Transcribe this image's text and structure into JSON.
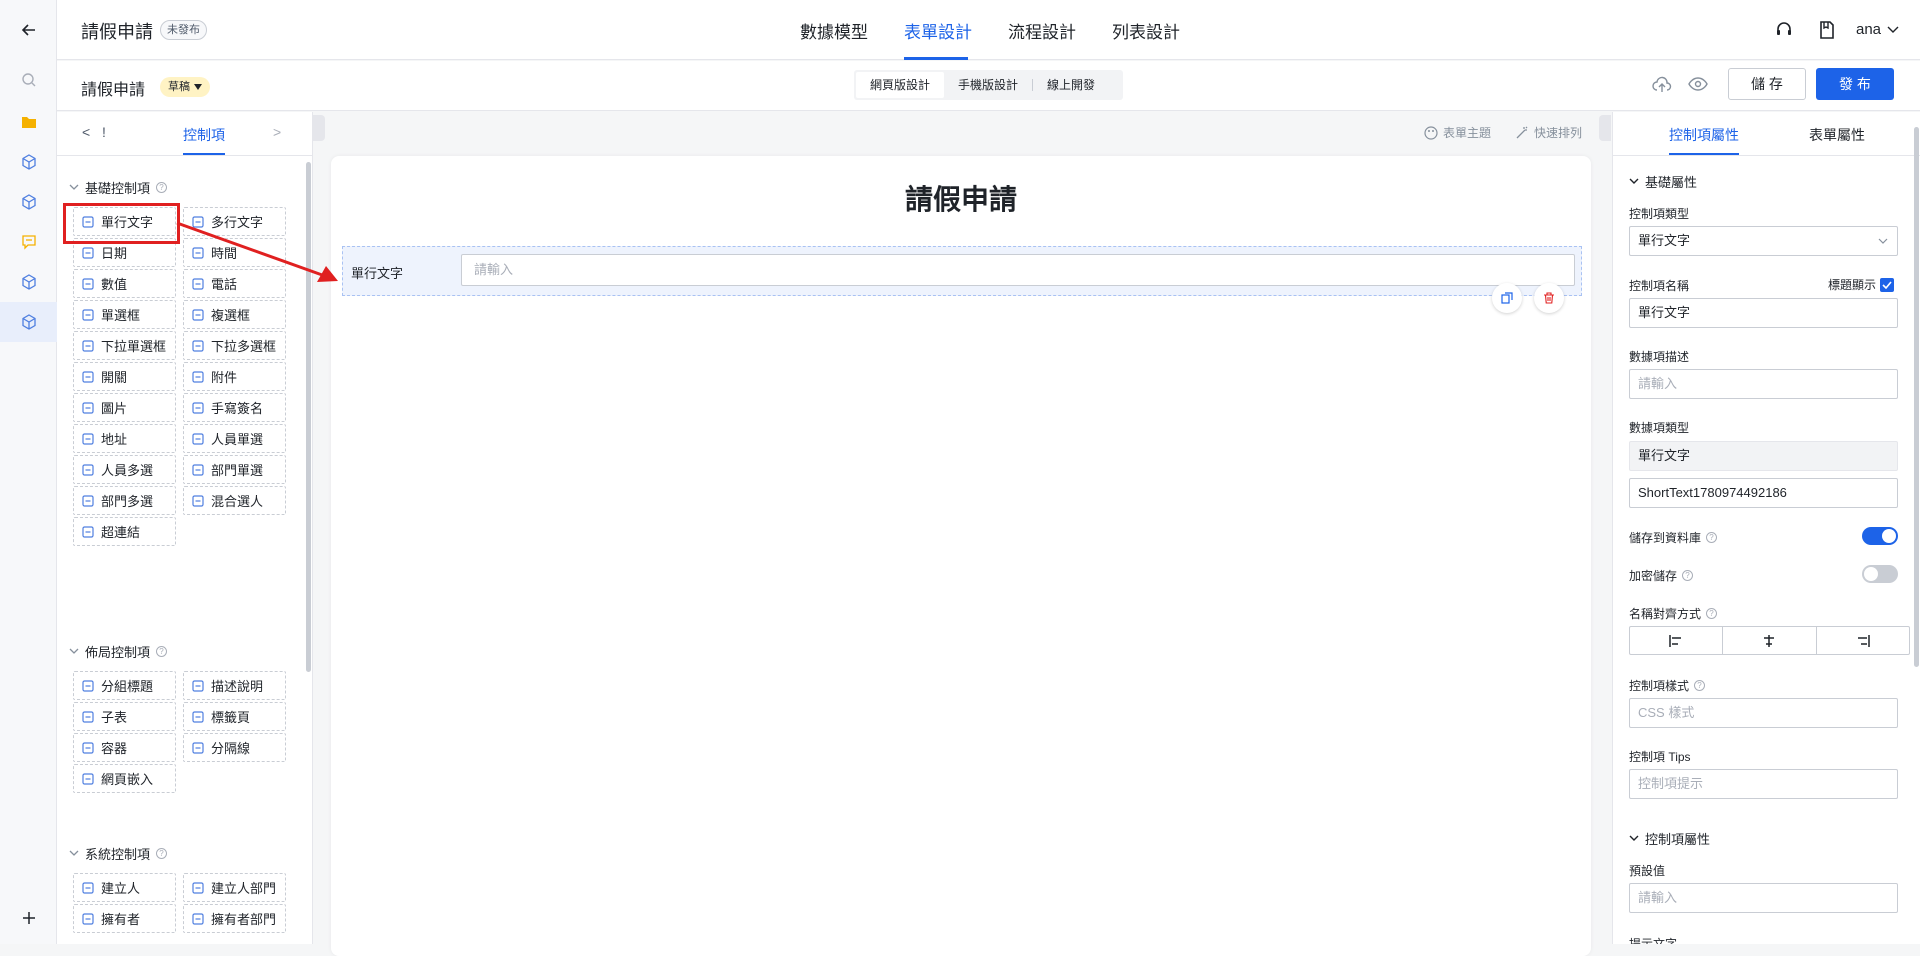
{
  "header": {
    "app_title": "請假申請",
    "status_badge": "未發布",
    "tabs": [
      "數據模型",
      "表單設計",
      "流程設計",
      "列表設計"
    ],
    "active_tab": "表單設計",
    "user": "ana"
  },
  "subheader": {
    "form_name": "請假申請",
    "draft_badge": "草稿",
    "modes": [
      "網頁版設計",
      "手機版設計",
      "線上開發"
    ],
    "save_label": "儲 存",
    "publish_label": "發 布"
  },
  "left_panel": {
    "nav_back": "<",
    "nav_mark": "!",
    "tab_label": "控制項",
    "nav_next": ">",
    "sections": [
      {
        "title": "基礎控制項",
        "items": [
          {
            "label": "單行文字",
            "icon": "single-line-text-icon"
          },
          {
            "label": "多行文字",
            "icon": "multi-line-text-icon"
          },
          {
            "label": "日期",
            "icon": "date-icon"
          },
          {
            "label": "時間",
            "icon": "time-icon"
          },
          {
            "label": "數值",
            "icon": "number-icon"
          },
          {
            "label": "電話",
            "icon": "phone-icon"
          },
          {
            "label": "單選框",
            "icon": "radio-icon"
          },
          {
            "label": "複選框",
            "icon": "checkbox-icon"
          },
          {
            "label": "下拉單選框",
            "icon": "dropdown-single-icon"
          },
          {
            "label": "下拉多選框",
            "icon": "dropdown-multi-icon"
          },
          {
            "label": "開關",
            "icon": "switch-icon"
          },
          {
            "label": "附件",
            "icon": "attachment-icon"
          },
          {
            "label": "圖片",
            "icon": "image-icon"
          },
          {
            "label": "手寫簽名",
            "icon": "signature-icon"
          },
          {
            "label": "地址",
            "icon": "address-icon"
          },
          {
            "label": "人員單選",
            "icon": "person-single-icon"
          },
          {
            "label": "人員多選",
            "icon": "person-multi-icon"
          },
          {
            "label": "部門單選",
            "icon": "dept-single-icon"
          },
          {
            "label": "部門多選",
            "icon": "dept-multi-icon"
          },
          {
            "label": "混合選人",
            "icon": "mixed-select-icon"
          },
          {
            "label": "超連結",
            "icon": "link-icon"
          }
        ]
      },
      {
        "title": "佈局控制項",
        "items": [
          {
            "label": "分組標題",
            "icon": "group-title-icon"
          },
          {
            "label": "描述說明",
            "icon": "description-icon"
          },
          {
            "label": "子表",
            "icon": "subtable-icon"
          },
          {
            "label": "標籤頁",
            "icon": "tabs-icon"
          },
          {
            "label": "容器",
            "icon": "container-icon"
          },
          {
            "label": "分隔線",
            "icon": "divider-icon"
          },
          {
            "label": "網頁嵌入",
            "icon": "webpage-embed-icon"
          }
        ]
      },
      {
        "title": "系統控制項",
        "items": [
          {
            "label": "建立人",
            "icon": "creator-icon"
          },
          {
            "label": "建立人部門",
            "icon": "creator-dept-icon"
          },
          {
            "label": "擁有者",
            "icon": "owner-icon"
          },
          {
            "label": "擁有者部門",
            "icon": "owner-dept-icon"
          }
        ]
      }
    ]
  },
  "canvas": {
    "tool_theme": "表單主題",
    "tool_arrange": "快速排列",
    "form_title": "請假申請",
    "field_label": "單行文字",
    "field_placeholder": "請輸入"
  },
  "right_panel": {
    "tabs": [
      "控制項屬性",
      "表單屬性"
    ],
    "basic_section": "基礎屬性",
    "control_type_label": "控制項類型",
    "control_type_value": "單行文字",
    "control_name_label": "控制項名稱",
    "title_display_label": "標題顯示",
    "control_name_value": "單行文字",
    "data_desc_label": "數據項描述",
    "data_desc_placeholder": "請輸入",
    "data_type_label": "數據項類型",
    "data_type_value": "單行文字",
    "field_code_value": "ShortText1780974492186",
    "save_db_label": "儲存到資料庫",
    "save_db_on": true,
    "encrypt_label": "加密儲存",
    "encrypt_on": false,
    "align_label": "名稱對齊方式",
    "style_label": "控制項樣式",
    "style_placeholder": "CSS 樣式",
    "tips_label": "控制項 Tips",
    "tips_placeholder": "控制項提示",
    "control_section": "控制項屬性",
    "default_label": "預設值",
    "default_placeholder": "請輸入",
    "hint_label": "提示文字"
  },
  "colors": {
    "accent": "#1d63e8",
    "highlight": "#e02020",
    "draft_bg": "#fff3c4"
  }
}
